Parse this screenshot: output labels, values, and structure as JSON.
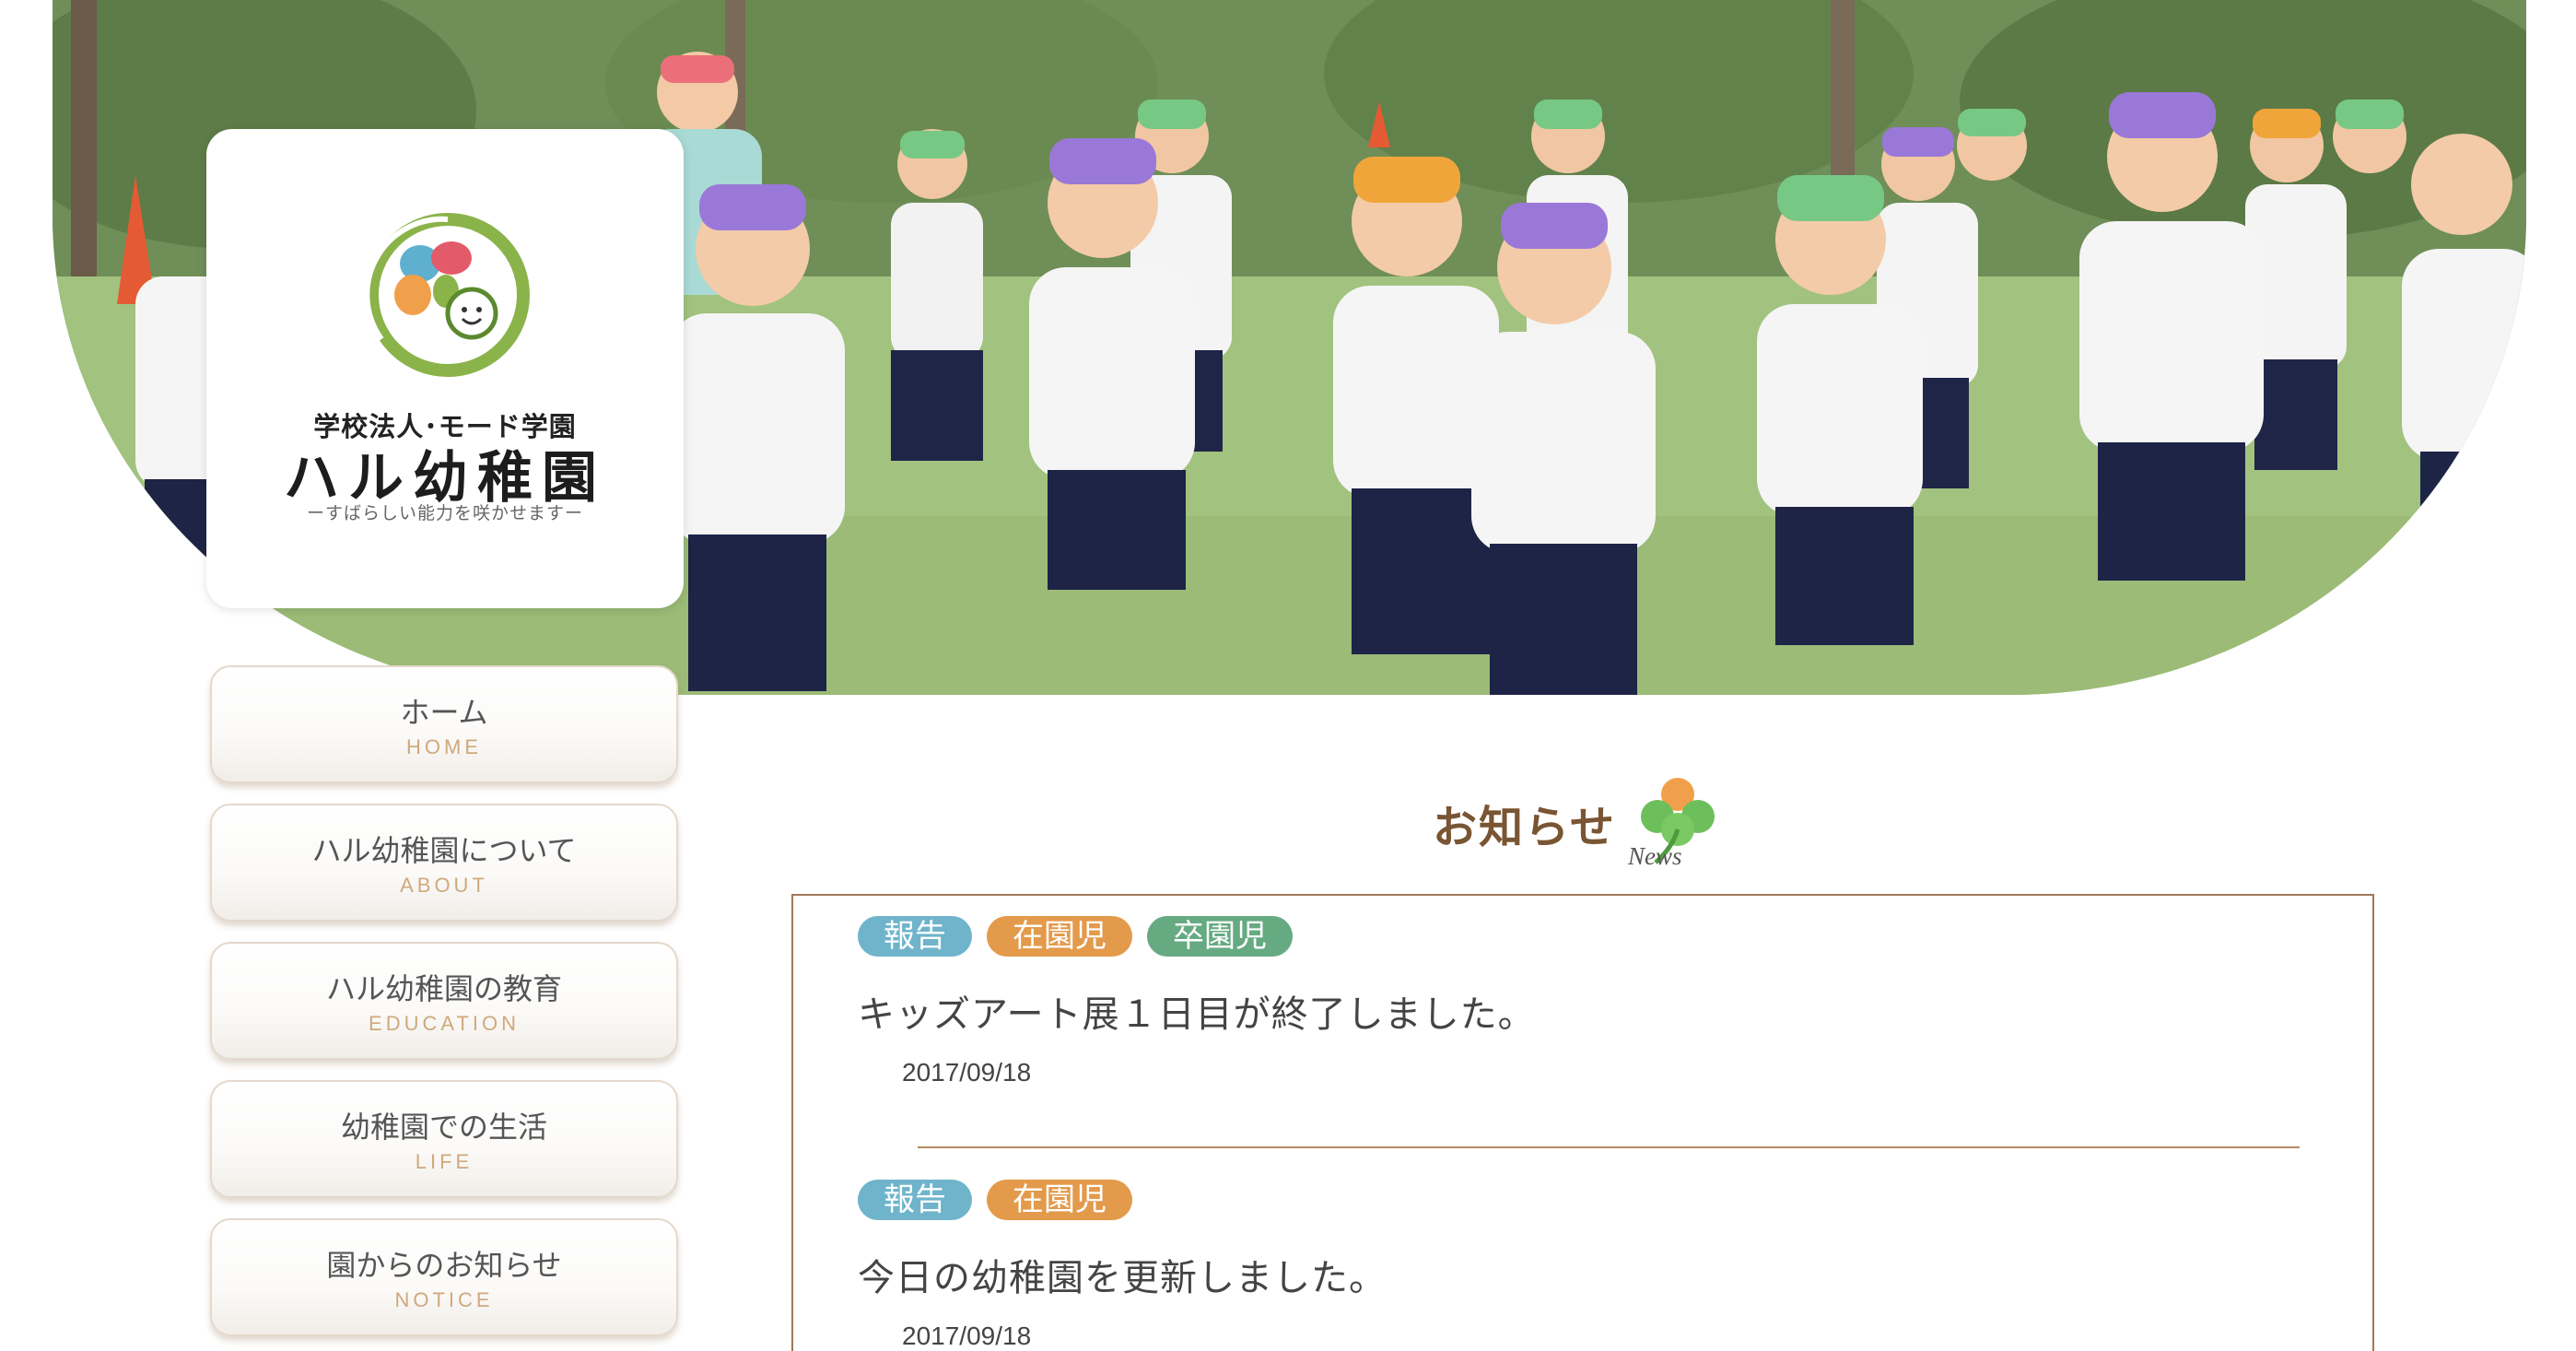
{
  "logo": {
    "org": "学校法人･モード学園",
    "name": "ハル幼稚園",
    "tagline": "ーすばらしい能力を咲かせますー"
  },
  "nav": {
    "items": [
      {
        "label": "ホーム",
        "en": "HOME"
      },
      {
        "label": "ハル幼稚園について",
        "en": "ABOUT"
      },
      {
        "label": "ハル幼稚園の教育",
        "en": "EDUCATION"
      },
      {
        "label": "幼稚園での生活",
        "en": "LIFE"
      },
      {
        "label": "園からのお知らせ",
        "en": "NOTICE"
      }
    ]
  },
  "news": {
    "heading": "お知らせ",
    "sub": "News",
    "entries": [
      {
        "tags": [
          "報告",
          "在園児",
          "卒園児"
        ],
        "title": "キッズアート展１日目が終了しました。",
        "date": "2017/09/18"
      },
      {
        "tags": [
          "報告",
          "在園児"
        ],
        "title": "今日の幼稚園を更新しました。",
        "date": "2017/09/18"
      }
    ]
  },
  "colors": {
    "accent_brown": "#7a5533",
    "tag_report": "#6fb4cb",
    "tag_current": "#e39a4b",
    "tag_graduate": "#66aa82",
    "nav_en": "#cfa97b"
  },
  "icons": [
    "clover-icon",
    "logo-mark-icon"
  ]
}
